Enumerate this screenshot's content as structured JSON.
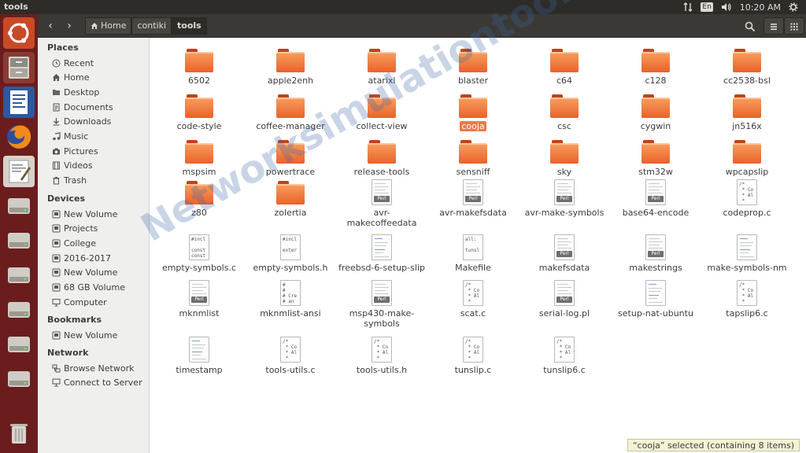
{
  "window": {
    "title": "tools"
  },
  "tray": {
    "keyboard": "En",
    "clock": "10:20 AM"
  },
  "breadcrumb": [
    {
      "label": "Home",
      "icon": "home-icon"
    },
    {
      "label": "contiki"
    },
    {
      "label": "tools",
      "active": true
    }
  ],
  "sidebar": {
    "places": {
      "heading": "Places",
      "items": [
        {
          "label": "Recent",
          "icon": "clock-icon"
        },
        {
          "label": "Home",
          "icon": "home-icon"
        },
        {
          "label": "Desktop",
          "icon": "folder-icon"
        },
        {
          "label": "Documents",
          "icon": "document-icon"
        },
        {
          "label": "Downloads",
          "icon": "download-icon"
        },
        {
          "label": "Music",
          "icon": "music-icon"
        },
        {
          "label": "Pictures",
          "icon": "camera-icon"
        },
        {
          "label": "Videos",
          "icon": "film-icon"
        },
        {
          "label": "Trash",
          "icon": "trash-icon"
        }
      ]
    },
    "devices": {
      "heading": "Devices",
      "items": [
        {
          "label": "New Volume",
          "icon": "drive-icon"
        },
        {
          "label": "Projects",
          "icon": "drive-icon",
          "eject": true
        },
        {
          "label": "College",
          "icon": "drive-icon"
        },
        {
          "label": "2016-2017",
          "icon": "drive-icon"
        },
        {
          "label": "New Volume",
          "icon": "drive-icon"
        },
        {
          "label": "68 GB Volume",
          "icon": "drive-icon"
        },
        {
          "label": "Computer",
          "icon": "computer-icon"
        }
      ]
    },
    "bookmarks": {
      "heading": "Bookmarks",
      "items": [
        {
          "label": "New Volume",
          "icon": "drive-icon"
        }
      ]
    },
    "network": {
      "heading": "Network",
      "items": [
        {
          "label": "Browse Network",
          "icon": "network-icon"
        },
        {
          "label": "Connect to Server",
          "icon": "server-icon"
        }
      ]
    }
  },
  "files": [
    [
      {
        "name": "6502",
        "type": "folder"
      },
      {
        "name": "apple2enh",
        "type": "folder"
      },
      {
        "name": "atarixl",
        "type": "folder"
      },
      {
        "name": "blaster",
        "type": "folder"
      },
      {
        "name": "c64",
        "type": "folder"
      },
      {
        "name": "c128",
        "type": "folder"
      },
      {
        "name": "cc2538-bsl",
        "type": "folder"
      }
    ],
    [
      {
        "name": "code-style",
        "type": "folder"
      },
      {
        "name": "coffee-manager",
        "type": "folder"
      },
      {
        "name": "collect-view",
        "type": "folder"
      },
      {
        "name": "cooja",
        "type": "folder",
        "selected": true
      },
      {
        "name": "csc",
        "type": "folder"
      },
      {
        "name": "cygwin",
        "type": "folder"
      },
      {
        "name": "jn516x",
        "type": "folder"
      }
    ],
    [
      {
        "name": "mspsim",
        "type": "folder"
      },
      {
        "name": "powertrace",
        "type": "folder"
      },
      {
        "name": "release-tools",
        "type": "folder"
      },
      {
        "name": "sensniff",
        "type": "folder"
      },
      {
        "name": "sky",
        "type": "folder"
      },
      {
        "name": "stm32w",
        "type": "folder"
      },
      {
        "name": "wpcapslip",
        "type": "folder"
      }
    ],
    [
      {
        "name": "z80",
        "type": "folder"
      },
      {
        "name": "zolertia",
        "type": "folder"
      },
      {
        "name": "avr-makecoffeedata",
        "type": "perl",
        "lines": [
          "avr-",
          "makecoffeedata"
        ]
      },
      {
        "name": "avr-makefsdata",
        "type": "perl"
      },
      {
        "name": "avr-make-symbols",
        "type": "perl"
      },
      {
        "name": "base64-encode",
        "type": "perl"
      },
      {
        "name": "codeprop.c",
        "type": "csrc"
      }
    ],
    [
      {
        "name": "empty-symbols.c",
        "type": "code",
        "preview": "#incl\n\nconst\nconst"
      },
      {
        "name": "empty-symbols.h",
        "type": "code",
        "preview": "#incl\n\nexter"
      },
      {
        "name": "freebsd-6-setup-slip",
        "type": "text"
      },
      {
        "name": "Makefile",
        "type": "code",
        "preview": "all:\n\ntunsl"
      },
      {
        "name": "makefsdata",
        "type": "perl"
      },
      {
        "name": "makestrings",
        "type": "perl"
      },
      {
        "name": "make-symbols-nm",
        "type": "text"
      }
    ],
    [
      {
        "name": "mknmlist",
        "type": "perl"
      },
      {
        "name": "mknmlist-ansi",
        "type": "code",
        "preview": "#\n#\n# Cre\n# an"
      },
      {
        "name": "msp430-make-symbols",
        "type": "perl",
        "lines": [
          "msp430-make-",
          "symbols"
        ]
      },
      {
        "name": "scat.c",
        "type": "csrc"
      },
      {
        "name": "serial-log.pl",
        "type": "perl"
      },
      {
        "name": "setup-nat-ubuntu",
        "type": "text"
      },
      {
        "name": "tapslip6.c",
        "type": "csrc"
      }
    ],
    [
      {
        "name": "timestamp",
        "type": "text"
      },
      {
        "name": "tools-utils.c",
        "type": "csrc"
      },
      {
        "name": "tools-utils.h",
        "type": "csrc"
      },
      {
        "name": "tunslip.c",
        "type": "csrc"
      },
      {
        "name": "tunslip6.c",
        "type": "csrc"
      }
    ]
  ],
  "csrc_preview": "/*\n * Co\n * Al\n *",
  "perl_badge": "Perl",
  "watermark": "Networksimulationtools.com",
  "status": "“cooja” selected  (containing 8 items)",
  "colors": {
    "accent": "#f07746",
    "launcher": "#6b1d1d",
    "toolbar": "#3a3935"
  }
}
